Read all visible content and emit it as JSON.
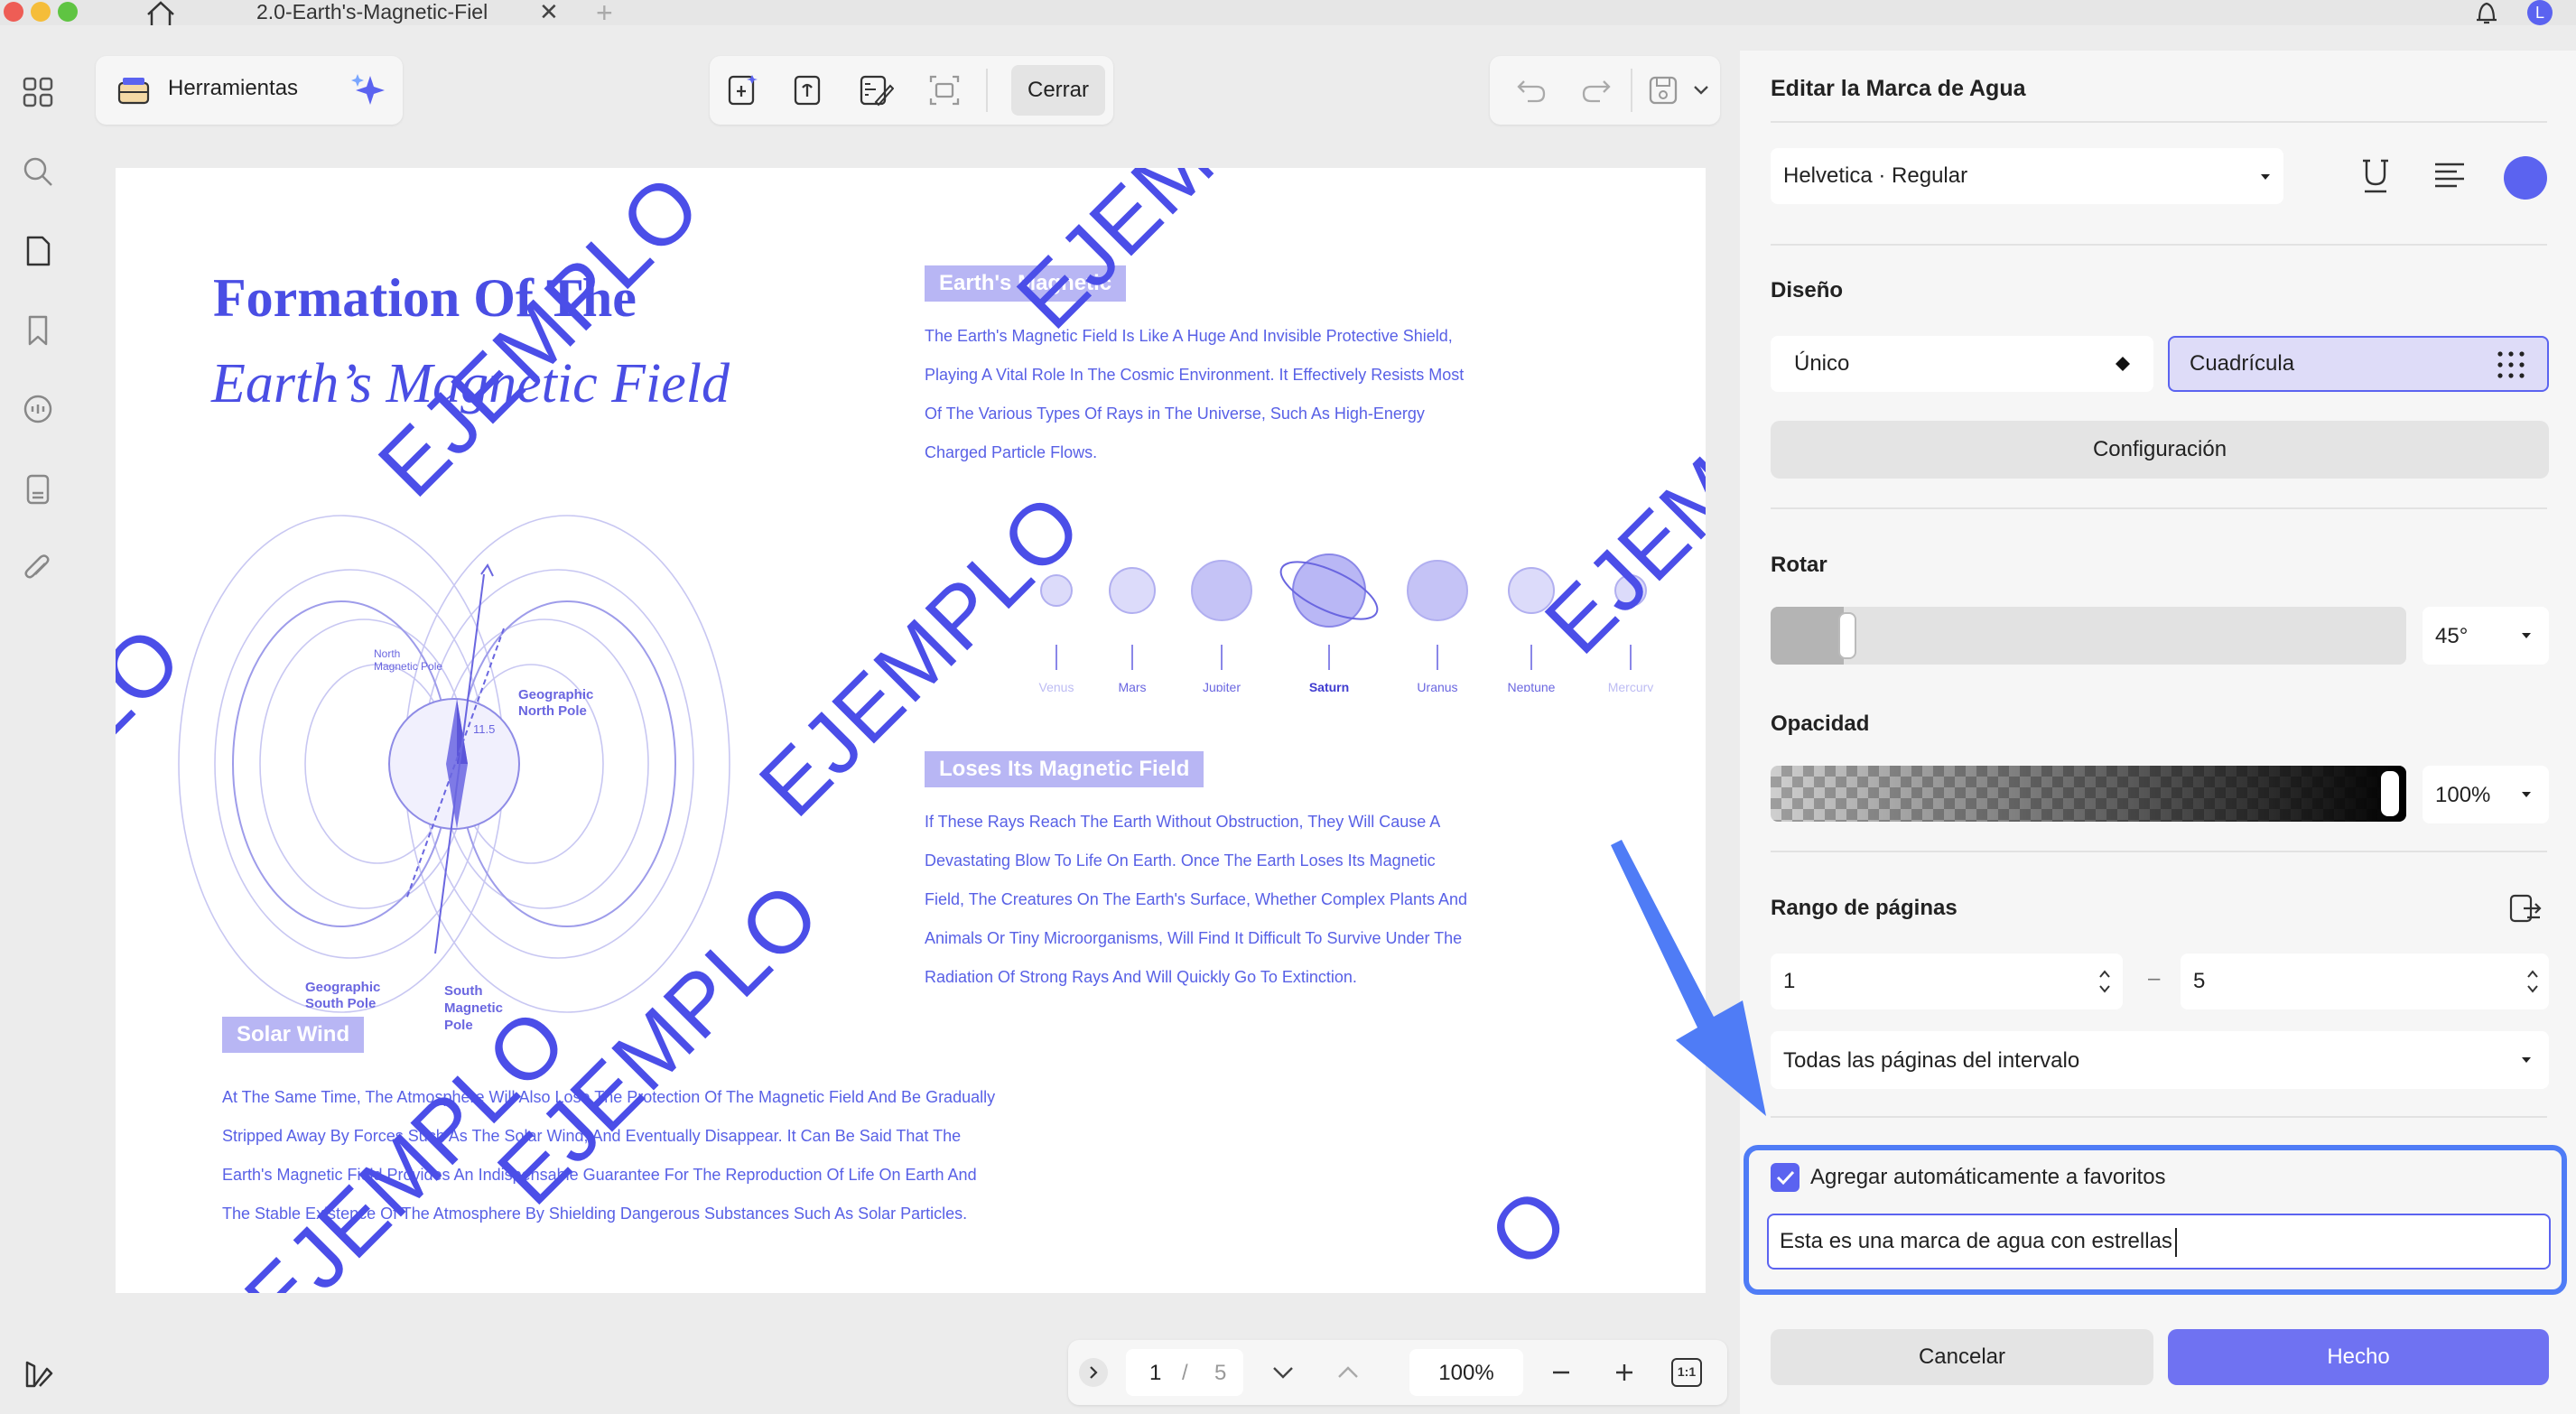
{
  "tab": {
    "title": "2.0-Earth's-Magnetic-Fiel",
    "close_glyph": "✕",
    "add_glyph": "+"
  },
  "avatar_letter": "L",
  "colors": {
    "accent": "#5b63f0",
    "watermark": "#4b4ee8",
    "doc_text": "#5860e6",
    "header_bg": "#b8b6f4",
    "done_button": "#6f72f2"
  },
  "toolbar": {
    "tools_label": "Herramientas",
    "close_label": "Cerrar"
  },
  "document": {
    "title_line1": "Formation Of The",
    "title_line2": "Earth’s Magnetic Field",
    "diagram_labels": {
      "north_magnetic_pole": "North Magnetic Pole",
      "north_line1": "North",
      "north_line2": "Magnetic Pole",
      "geographic_north_1": "Geographic",
      "geographic_north_2": "North Pole",
      "angle": "11.5",
      "geographic_south_1": "Geographic",
      "geographic_south_2": "South Pole",
      "south_magnetic_1": "South",
      "south_magnetic_2": "Magnetic",
      "south_magnetic_3": "Pole"
    },
    "section1": {
      "header": "Earth's Magnetic",
      "lines": [
        "The Earth's Magnetic Field Is Like A Huge And Invisible Protective Shield,",
        "Playing A Vital Role In The Cosmic Environment. It Effectively Resists Most",
        "Of The Various Types Of Rays in The Universe, Such As High-Energy",
        "Charged Particle Flows."
      ]
    },
    "planets": [
      "Venus",
      "Mars",
      "Jupiter",
      "Saturn",
      "Uranus",
      "Neptune",
      "Mercury"
    ],
    "section2": {
      "header": "Loses Its Magnetic Field",
      "lines": [
        "If These Rays Reach The Earth Without Obstruction, They Will Cause A",
        "Devastating Blow To Life On Earth. Once The Earth Loses Its Magnetic",
        "Field, The Creatures On The Earth's Surface, Whether Complex Plants And",
        "Animals Or Tiny Microorganisms, Will Find It Difficult To Survive Under The",
        "Radiation Of Strong Rays And Will Quickly Go To Extinction."
      ]
    },
    "section3": {
      "header": "Solar Wind",
      "lines": [
        "At The Same Time, The Atmosphere Will Also Lose The Protection Of The Magnetic Field And Be Gradually",
        "Stripped Away By Forces Such As The Solar Wind, And Eventually Disappear. It Can Be Said That The",
        "Earth's Magnetic Field Provides An Indispensable Guarantee For The Reproduction Of Life On Earth And",
        "The Stable Existence Of The Atmosphere By Shielding Dangerous Substances Such As Solar Particles."
      ]
    },
    "watermark_text": "EJEMPLO",
    "watermark_fragments": {
      "top_left": "EJ",
      "left_edge": "MPLO",
      "right_edge": "EJEM",
      "bottom_right": "O"
    }
  },
  "nav": {
    "current_page": "1",
    "separator": "/",
    "total_pages": "5",
    "zoom": "100%",
    "fit_label": "1:1"
  },
  "panel": {
    "title": "Editar la Marca de Agua",
    "font_value": "Helvetica · Regular",
    "design_label": "Diseño",
    "option_single": "Único",
    "option_grid": "Cuadrícula",
    "config_button": "Configuración",
    "rotate_label": "Rotar",
    "rotate_value": "45°",
    "rotate_level": 0.03,
    "opacity_label": "Opacidad",
    "opacity_value": "100%",
    "opacity_level": 1.0,
    "range_label": "Rango de páginas",
    "range_from": "1",
    "range_dash": "–",
    "range_to": "5",
    "range_mode": "Todas las páginas del intervalo",
    "auto_fav_label": "Agregar automáticamente a favoritos",
    "auto_fav_checked": true,
    "watermark_input": "Esta es una marca de agua con estrellas",
    "cancel_button": "Cancelar",
    "done_button": "Hecho"
  }
}
